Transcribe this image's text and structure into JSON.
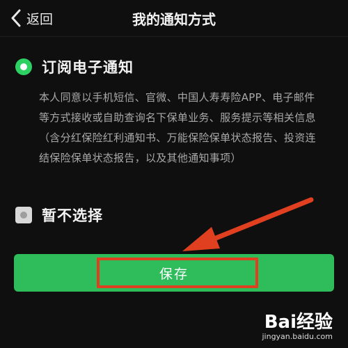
{
  "header": {
    "back_label": "返回",
    "title": "我的通知方式"
  },
  "options": [
    {
      "label": "订阅电子通知",
      "selected": true,
      "description": "本人同意以手机短信、官微、中国人寿寿险APP、电子邮件等方式接收或自助查询名下保单业务、服务提示等相关信息（含分红保险红利通知书、万能保险保单状态报告、投资连结保险保单状态报告，以及其他通知事项）"
    },
    {
      "label": "暂不选择",
      "selected": false
    }
  ],
  "save_button": {
    "label": "保存"
  },
  "colors": {
    "accent_green": "#2fbd5c",
    "radio_green": "#2fd063",
    "annotation_red": "#e0401f",
    "background": "#0f0f0f"
  },
  "watermark": {
    "brand": "Bai经验",
    "url": "jingyan.baidu.com"
  }
}
